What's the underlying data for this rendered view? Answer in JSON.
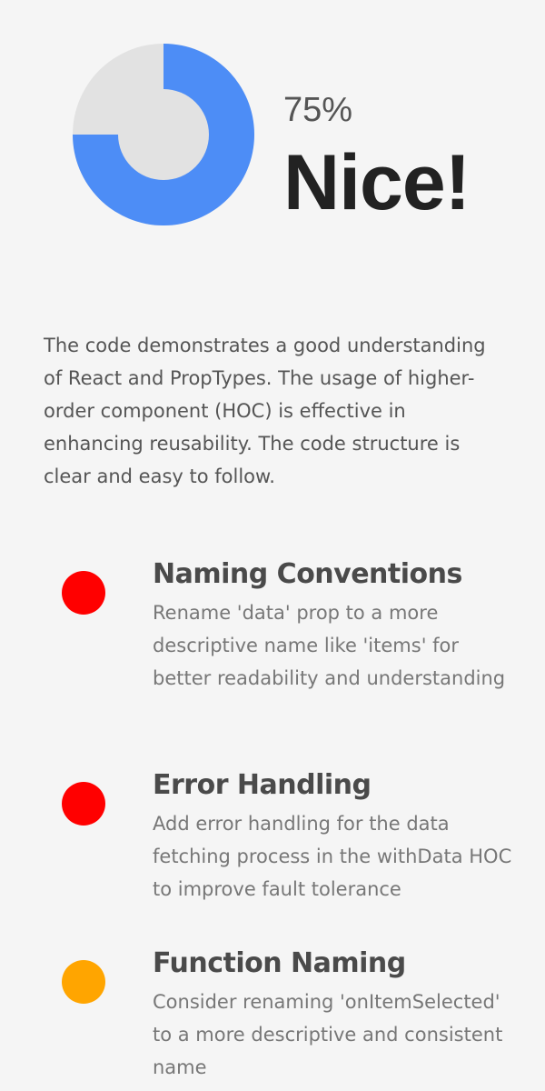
{
  "score": {
    "percent_label": "75%",
    "percent_value": 75,
    "verdict": "Nice!",
    "fill_color": "#4d8df6",
    "track_color": "#e2e2e2"
  },
  "summary": "The code demonstrates a good understanding of React and PropTypes. The usage of higher-order component (HOC) is effective in enhancing reusability. The code structure is clear and easy to follow.",
  "issues": [
    {
      "severity_color": "#ff0000",
      "title": "Naming Conventions",
      "description": "Rename 'data' prop to a more descriptive name like 'items' for better readability and understanding"
    },
    {
      "severity_color": "#ff0000",
      "title": "Error Handling",
      "description": "Add error handling for the data fetching process in the withData HOC to improve fault tolerance"
    },
    {
      "severity_color": "#ffa500",
      "title": "Function Naming",
      "description": "Consider renaming 'onItemSelected' to a more descriptive and consistent name"
    }
  ]
}
